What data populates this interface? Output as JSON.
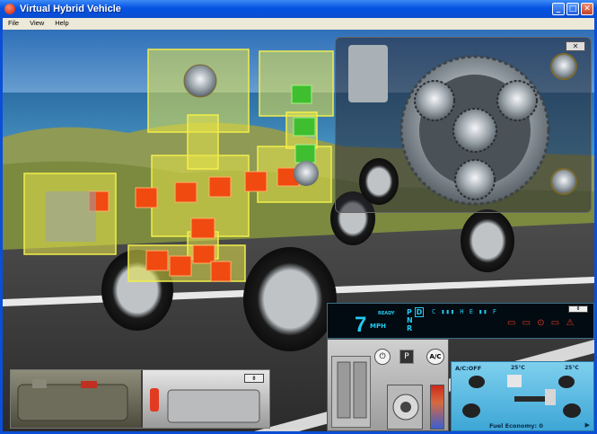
{
  "window": {
    "title": "Virtual Hybrid Vehicle",
    "buttons": {
      "minimize": "_",
      "maximize": "□",
      "close": "✕"
    }
  },
  "menu": {
    "items": [
      "File",
      "View",
      "Help"
    ]
  },
  "gear_panel": {
    "close_label": "✕"
  },
  "bottom_panel": {
    "button_label": "⇟"
  },
  "dashboard": {
    "speed": "7",
    "speed_unit": "MPH",
    "ready": "READY",
    "gear_p": "P",
    "gear_d": "D",
    "gear_n": "N",
    "gear_r": "R",
    "gauge_temp": "C ▮▮▮ H",
    "gauge_fuel": "E ▮▮ F",
    "warning_icons": "▭ ▭ ⊙ ▭ ⚠",
    "close_label": "⇟"
  },
  "controls": {
    "power_icon": "power-icon",
    "park_label": "P",
    "ac_label": "A/C",
    "shift_labels": [
      "D",
      "R",
      "N"
    ]
  },
  "energy_monitor": {
    "ac_status": "A/C:OFF",
    "inside_temp": "25°C",
    "outside_temp": "25°C",
    "fuel_economy": "Fuel Economy: 0",
    "next_icon": "▶"
  },
  "colors": {
    "titlebar": "#0553e1",
    "dash_accent": "#23c9f0",
    "energy_bg": "#5cbfe5",
    "highlight_yellow": "#e5e34a",
    "flow_orange": "#f04a10",
    "flow_green": "#3fbf2f"
  }
}
